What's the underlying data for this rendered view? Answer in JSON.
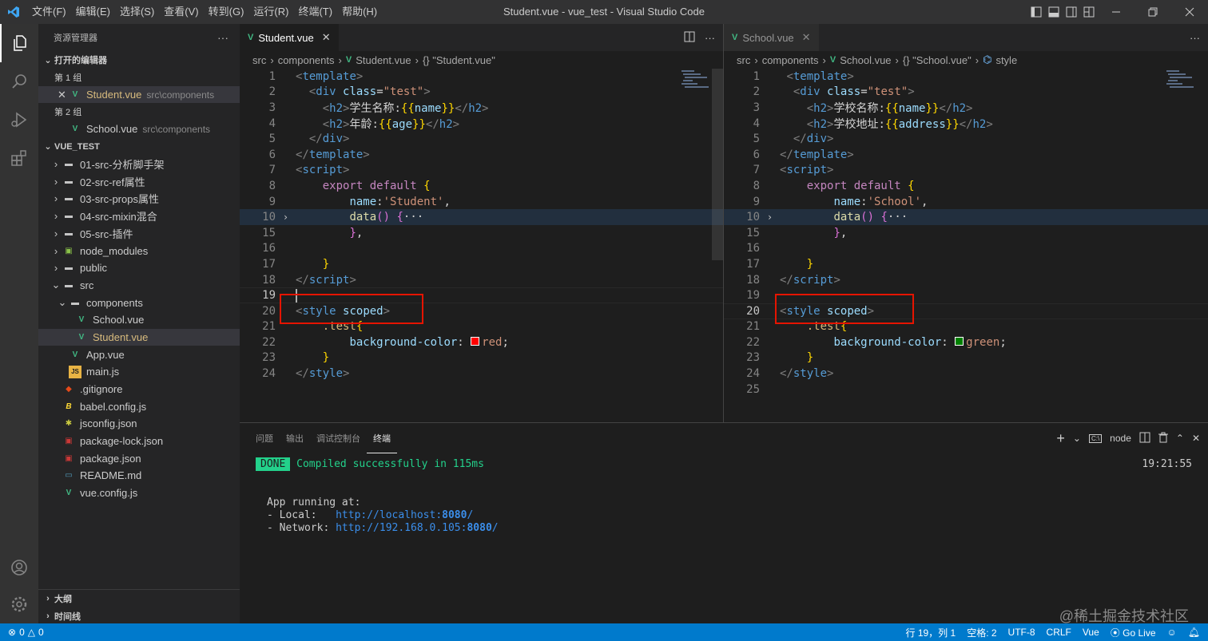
{
  "titlebar": {
    "title": "Student.vue - vue_test - Visual Studio Code",
    "menu": [
      "文件(F)",
      "编辑(E)",
      "选择(S)",
      "查看(V)",
      "转到(G)",
      "运行(R)",
      "终端(T)",
      "帮助(H)"
    ]
  },
  "sidebar": {
    "title": "资源管理器",
    "open_editors_label": "打开的编辑器",
    "group1_label": "第 1 组",
    "group1_file": "Student.vue",
    "group1_path": "src\\components",
    "group2_label": "第 2 组",
    "group2_file": "School.vue",
    "group2_path": "src\\components",
    "project_label": "VUE_TEST",
    "tree": [
      "01-src-分析脚手架",
      "02-src-ref属性",
      "03-src-props属性",
      "04-src-mixin混合",
      "05-src-插件",
      "node_modules",
      "public",
      "src",
      "components",
      "School.vue",
      "Student.vue",
      "App.vue",
      "main.js",
      ".gitignore",
      "babel.config.js",
      "jsconfig.json",
      "package-lock.json",
      "package.json",
      "README.md",
      "vue.config.js"
    ],
    "outline_label": "大纲",
    "timeline_label": "时间线"
  },
  "editor_left": {
    "tab": "Student.vue",
    "breadcrumb": [
      "src",
      "components",
      "Student.vue",
      "{} \"Student.vue\""
    ],
    "line_numbers": [
      "1",
      "2",
      "3",
      "4",
      "5",
      "6",
      "7",
      "8",
      "9",
      "10",
      "15",
      "16",
      "17",
      "18",
      "19",
      "20",
      "21",
      "22",
      "23",
      "24"
    ],
    "name_value": "'Student'",
    "h2_line3": "学生名称:",
    "h2_line4": "年龄:",
    "bind3": "name",
    "bind4": "age",
    "color_value": "red",
    "swatch_color": "#ff0000"
  },
  "editor_right": {
    "tab": "School.vue",
    "breadcrumb": [
      "src",
      "components",
      "School.vue",
      "{} \"School.vue\"",
      "style"
    ],
    "line_numbers": [
      "1",
      "2",
      "3",
      "4",
      "5",
      "6",
      "7",
      "8",
      "9",
      "10",
      "15",
      "16",
      "17",
      "18",
      "19",
      "20",
      "21",
      "22",
      "23",
      "24",
      "25"
    ],
    "name_value": "'School'",
    "h2_line3": "学校名称:",
    "h2_line4": "学校地址:",
    "bind3": "name",
    "bind4": "address",
    "color_value": "green",
    "swatch_color": "#008000"
  },
  "panel": {
    "tabs": [
      "问题",
      "输出",
      "调试控制台",
      "终端"
    ],
    "terminal_name": "node",
    "done_badge": "DONE",
    "compiled": "Compiled successfully in 115ms",
    "time": "19:21:55",
    "app_running": "App running at:",
    "local_label": "- Local:   ",
    "local_url": "http://localhost:",
    "local_port": "8080",
    "network_label": "- Network: ",
    "network_url": "http://192.168.0.105:",
    "network_port": "8080"
  },
  "statusbar": {
    "errors": "0",
    "warnings": "0",
    "position": "行 19，列 1",
    "spaces": "空格: 2",
    "encoding": "UTF-8",
    "eol": "CRLF",
    "language": "Vue",
    "golive": "Go Live"
  },
  "watermark": "@稀土掘金技术社区",
  "colors": {
    "accent": "#007acc",
    "highlight_box": "#e51400"
  }
}
